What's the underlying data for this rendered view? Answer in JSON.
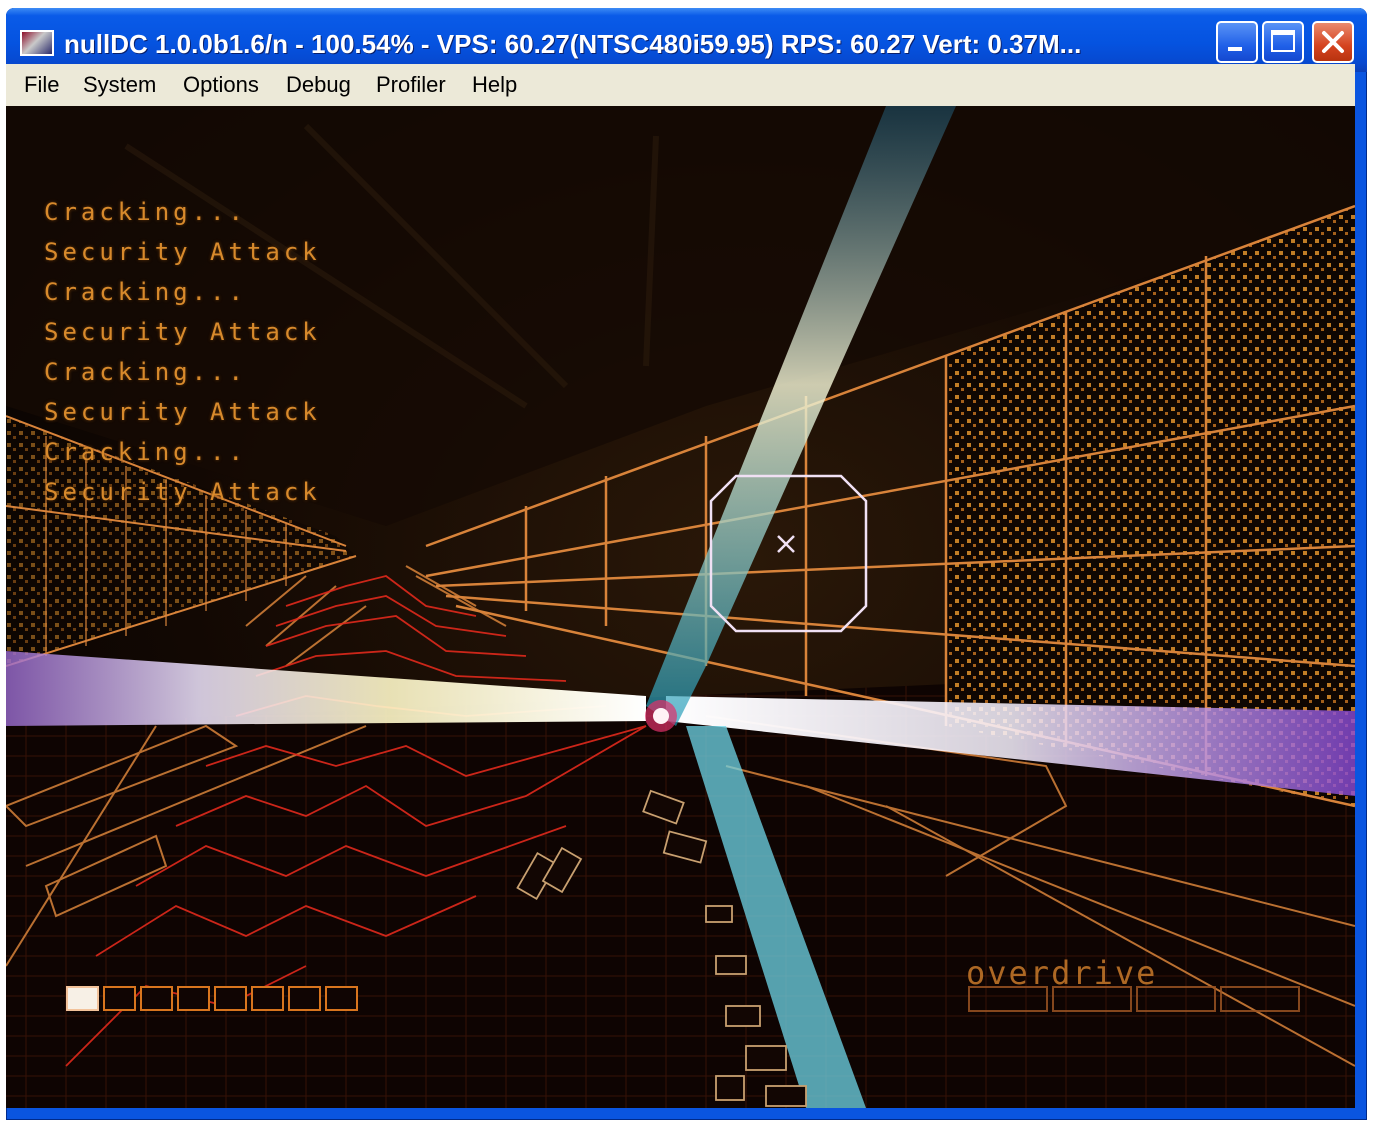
{
  "window": {
    "title": "nullDC 1.0.0b1.6/n - 100.54% - VPS: 60.27(NTSC480i59.95) RPS: 60.27 Vert: 0.37M...",
    "icon": "app-icon",
    "controls": [
      "minimize-icon",
      "maximize-icon",
      "close-icon"
    ]
  },
  "menu": {
    "items": [
      {
        "label": "File"
      },
      {
        "label": "System"
      },
      {
        "label": "Options"
      },
      {
        "label": "Debug"
      },
      {
        "label": "Profiler"
      },
      {
        "label": "Help"
      }
    ]
  },
  "hud": {
    "log": [
      "Cracking...",
      "Security Attack",
      "Cracking...",
      "Security Attack",
      "Cracking...",
      "Security Attack",
      "Cracking...",
      "Security Attack"
    ],
    "overdrive_label": "overdrive",
    "life_cells_total": 8,
    "life_cells_filled": 1,
    "overdrive_cells_total": 4,
    "overdrive_cells_filled": 0
  },
  "colors": {
    "titlebar": "#0553e0",
    "menubar": "#ece9d8",
    "hud_text": "#d88a2c",
    "wireframe": "#d8833a",
    "beam_cyan": "#7fe6f5",
    "laser_red": "#e0291c"
  }
}
